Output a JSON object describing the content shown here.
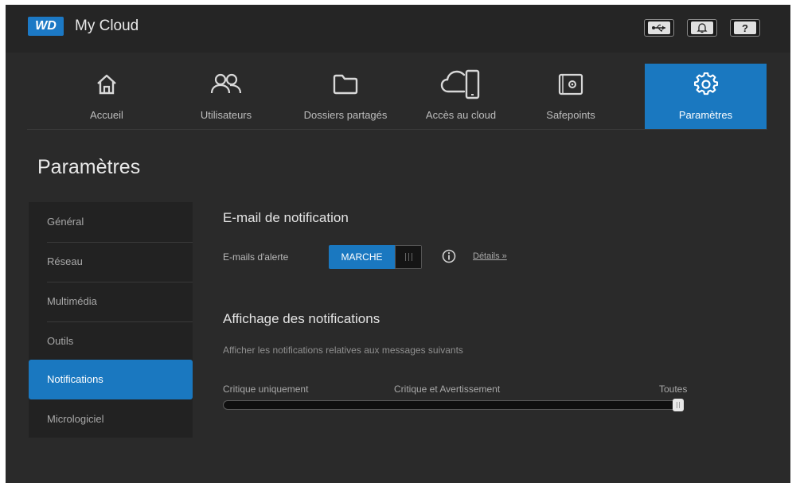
{
  "topbar": {
    "logo_text": "WD",
    "app_title": "My Cloud",
    "usb_icon": "usb-icon",
    "bell_icon": "bell-icon",
    "help_label": "?"
  },
  "nav": {
    "items": [
      {
        "label": "Accueil",
        "icon": "home-icon",
        "active": false
      },
      {
        "label": "Utilisateurs",
        "icon": "users-icon",
        "active": false
      },
      {
        "label": "Dossiers partagés",
        "icon": "folder-icon",
        "active": false
      },
      {
        "label": "Accès au cloud",
        "icon": "cloud-device-icon",
        "active": false
      },
      {
        "label": "Safepoints",
        "icon": "safe-icon",
        "active": false
      },
      {
        "label": "Paramètres",
        "icon": "gear-icon",
        "active": true
      }
    ]
  },
  "page": {
    "title": "Paramètres"
  },
  "sidebar": {
    "items": [
      {
        "label": "Général",
        "active": false
      },
      {
        "label": "Réseau",
        "active": false
      },
      {
        "label": "Multimédia",
        "active": false
      },
      {
        "label": "Outils",
        "active": false
      },
      {
        "label": "Notifications",
        "active": true
      },
      {
        "label": "Micrologiciel",
        "active": false
      }
    ]
  },
  "email_section": {
    "heading": "E-mail de notification",
    "alert_label": "E-mails d'alerte",
    "toggle_on_label": "MARCHE",
    "toggle_state": true,
    "details_link": "Détails »"
  },
  "display_section": {
    "heading": "Affichage des notifications",
    "description": "Afficher les notifications relatives aux messages suivants",
    "slider_labels": [
      "Critique uniquement",
      "Critique et Avertissement",
      "Toutes"
    ],
    "slider_value": "Toutes"
  },
  "colors": {
    "accent": "#1a78c0",
    "background": "#2a2a2a",
    "topbar": "#252525"
  }
}
